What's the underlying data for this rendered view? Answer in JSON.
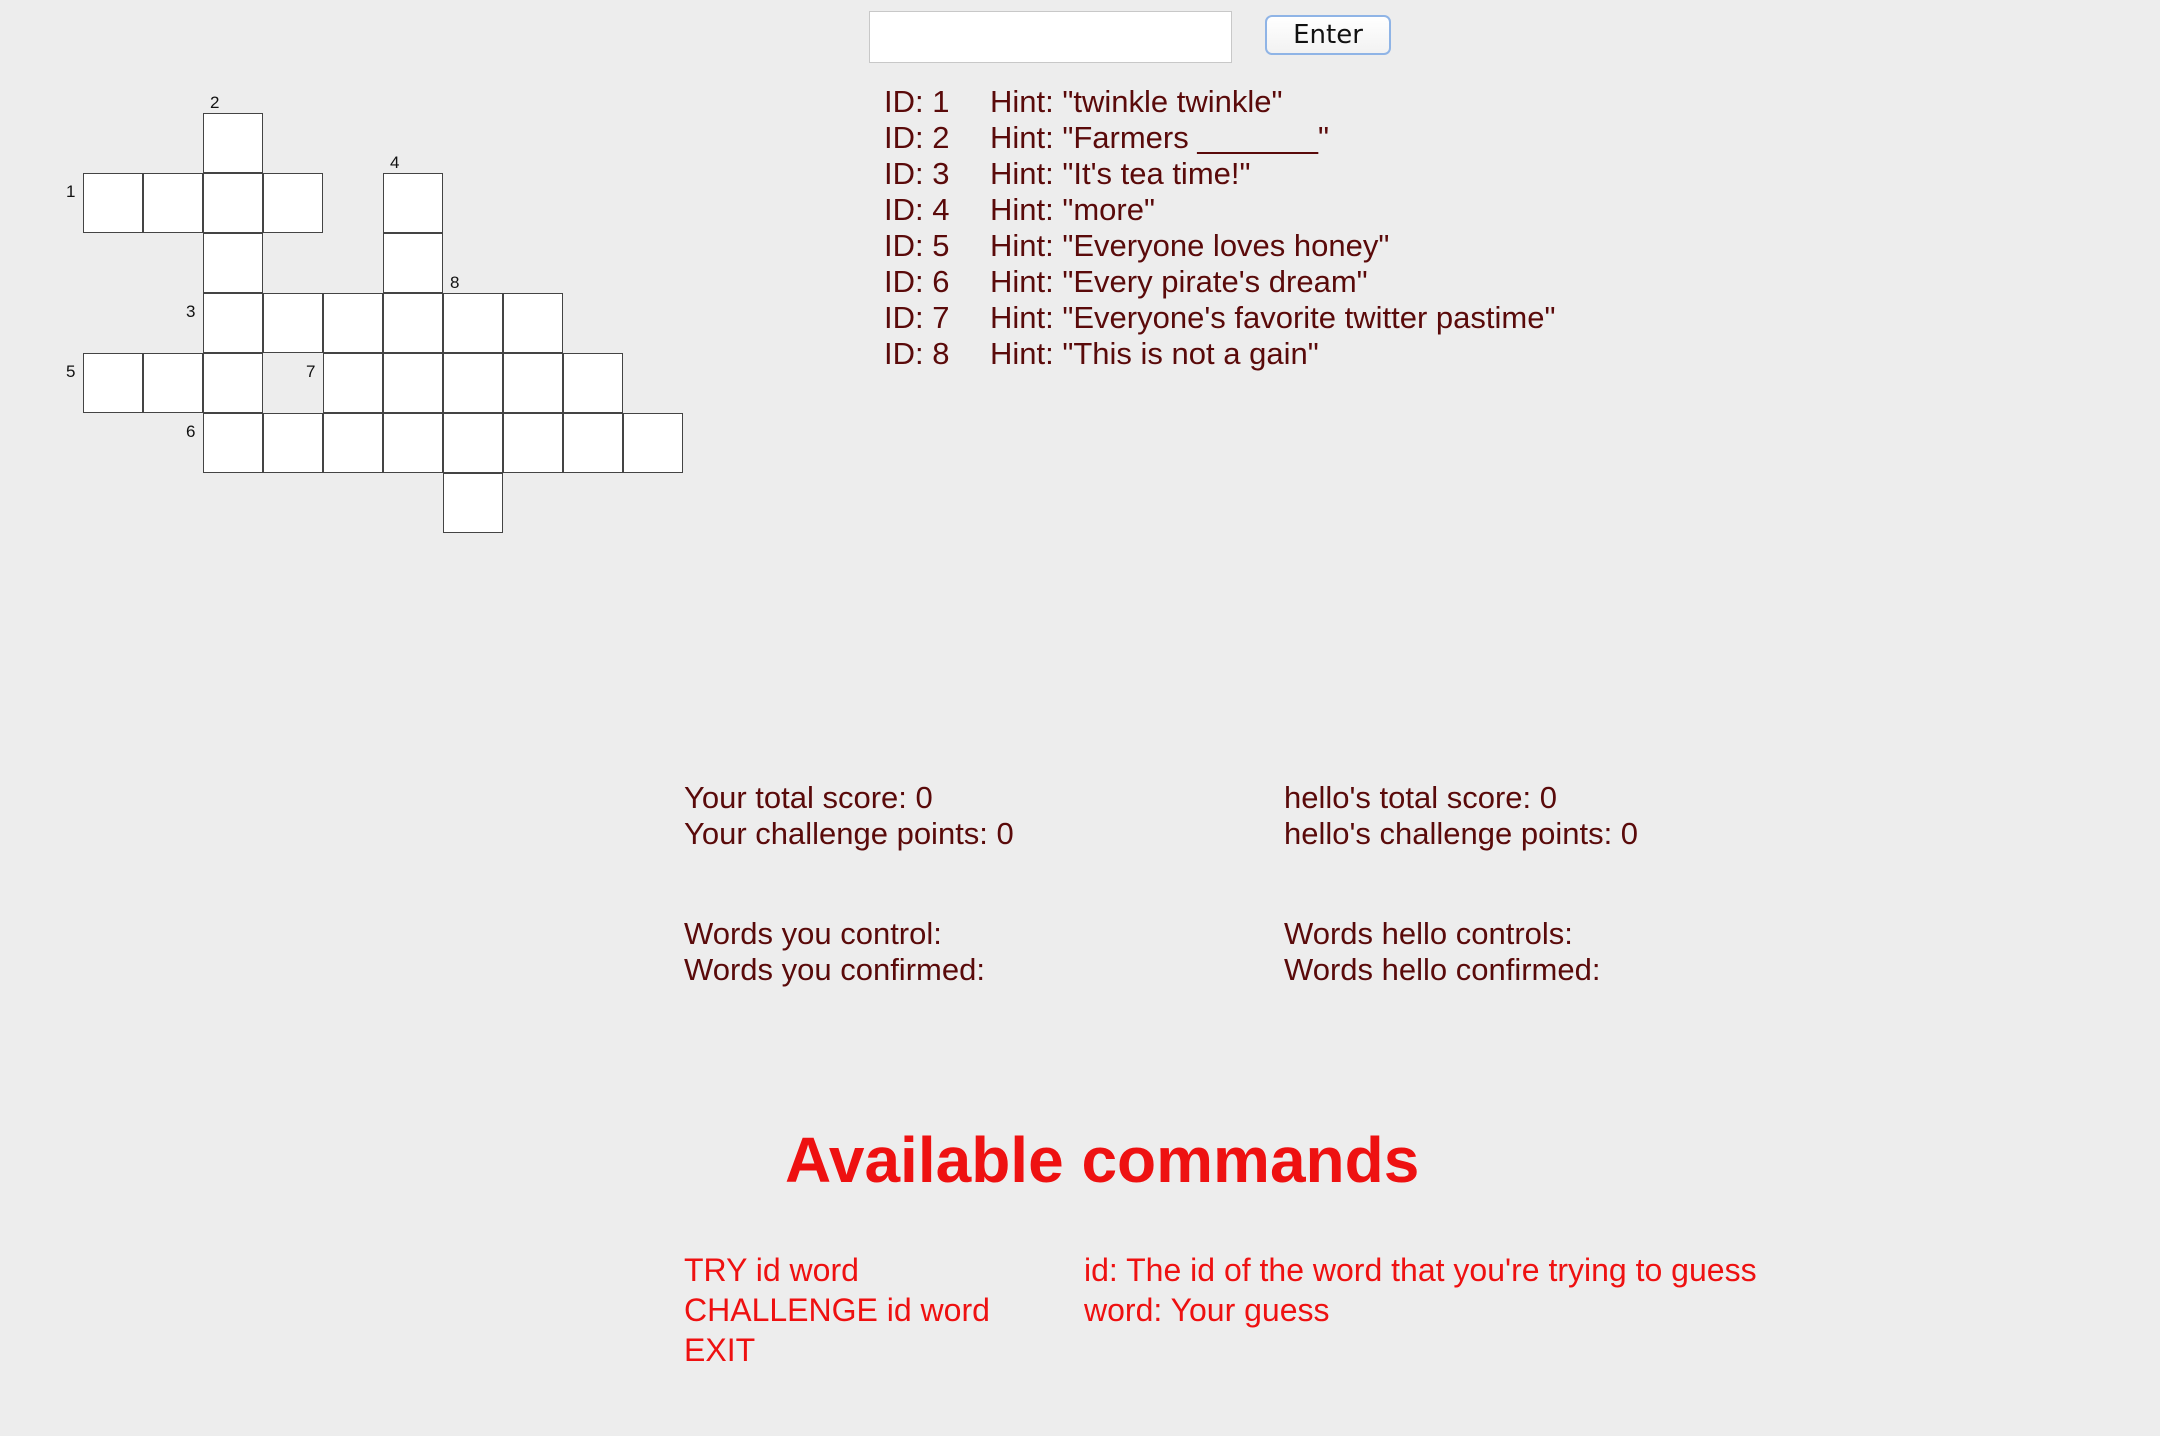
{
  "input": {
    "value": "",
    "placeholder": ""
  },
  "enter_button": {
    "label": "Enter"
  },
  "crossword": {
    "clue_numbers": [
      "2",
      "1",
      "4",
      "8",
      "3",
      "5",
      "7",
      "6"
    ]
  },
  "hints": [
    {
      "id": "ID: 1",
      "hint": "Hint: \"twinkle twinkle\""
    },
    {
      "id": "ID: 2",
      "hint": "Hint: \"Farmers _______\""
    },
    {
      "id": "ID: 3",
      "hint": "Hint: \"It's tea time!\""
    },
    {
      "id": "ID: 4",
      "hint": "Hint: \"more\""
    },
    {
      "id": "ID: 5",
      "hint": "Hint: \"Everyone loves honey\""
    },
    {
      "id": "ID: 6",
      "hint": "Hint: \"Every pirate's dream\""
    },
    {
      "id": "ID: 7",
      "hint": "Hint: \"Everyone's favorite twitter pastime\""
    },
    {
      "id": "ID: 8",
      "hint": "Hint: \"This is not a gain\""
    }
  ],
  "scores": {
    "you_total": "Your total score: 0",
    "you_challenge": "Your challenge points: 0",
    "opp_total": "hello's total score: 0",
    "opp_challenge": "hello's challenge points: 0"
  },
  "words": {
    "you_control": "Words you control:",
    "you_confirmed": "Words you confirmed:",
    "opp_control": "Words hello controls:",
    "opp_confirmed": "Words hello confirmed:"
  },
  "commands": {
    "title": "Available commands",
    "list": [
      "TRY id word",
      "CHALLENGE id word",
      "EXIT"
    ],
    "help": [
      "id: The id of the word that you're trying to guess",
      "word: Your guess"
    ]
  },
  "colors": {
    "background": "#ededed",
    "text_dark_red": "#5a0a0a",
    "commands_red": "#ee1111",
    "button_border": "#8fb4e6"
  }
}
